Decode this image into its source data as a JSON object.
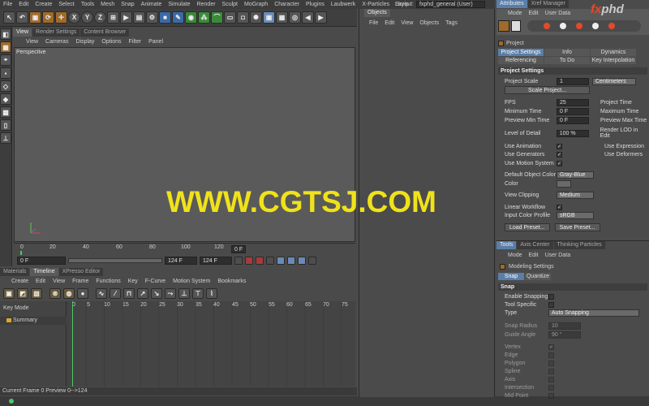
{
  "menubar": {
    "items": [
      "File",
      "Edit",
      "Create",
      "Select",
      "Tools",
      "Mesh",
      "Snap",
      "Animate",
      "Simulate",
      "Render",
      "Sculpt",
      "MoGraph",
      "Character",
      "Plugins",
      "Laubwerk",
      "X-Particles",
      "Scrip"
    ],
    "layout_label": "Layout:",
    "layout_value": "fxphd_general (User)"
  },
  "toolbar": {
    "axis_x": "X",
    "axis_y": "Y",
    "axis_z": "Z"
  },
  "viewport": {
    "tabs": [
      "View",
      "Render Settings",
      "Content Browser"
    ],
    "menu": [
      "View",
      "Cameras",
      "Display",
      "Options",
      "Filter",
      "Panel"
    ],
    "label": "Perspective"
  },
  "timeline_ruler": {
    "ticks": [
      "0",
      "20",
      "40",
      "60",
      "80",
      "100",
      "120"
    ],
    "end_frame": "0 F",
    "start_frame": "0 F",
    "end_value": "124 F",
    "mid_value": "124 F"
  },
  "bottom": {
    "tabs": [
      "Materials",
      "Timeline",
      "XPresso Editor"
    ],
    "menu": [
      "Create",
      "Edit",
      "View",
      "Frame",
      "Functions",
      "Key",
      "F-Curve",
      "Motion System",
      "Bookmarks"
    ],
    "key_mode": "Key Mode",
    "summary": "Summary",
    "ticks": [
      "0",
      "5",
      "10",
      "15",
      "20",
      "25",
      "30",
      "35",
      "40",
      "45",
      "50",
      "55",
      "60",
      "65",
      "70",
      "75"
    ],
    "status": "Current Frame  0  Preview  0-->124"
  },
  "objects": {
    "tab": "Objects",
    "menu": [
      "File",
      "Edit",
      "View",
      "Objects",
      "Tags"
    ]
  },
  "attributes": {
    "tabs": [
      "Attributes",
      "Xref Manager"
    ],
    "menu": [
      "Mode",
      "Edit",
      "User Data"
    ],
    "project_label": "Project",
    "buttons": [
      "Project Settings",
      "Info",
      "Dynamics",
      "Referencing",
      "To Do",
      "Key Interpolation"
    ],
    "section": "Project Settings",
    "project_scale_label": "Project Scale",
    "project_scale_value": "1",
    "project_scale_unit": "Centimeters",
    "scale_project": "Scale Project...",
    "fps_label": "FPS",
    "fps_value": "25",
    "project_time_label": "Project Time",
    "min_time_label": "Minimum Time",
    "min_time_value": "0 F",
    "max_time_label": "Maximum Time",
    "preview_min_label": "Preview Min Time",
    "preview_min_value": "0 F",
    "preview_max_label": "Preview Max Time",
    "lod_label": "Level of Detail",
    "lod_value": "100 %",
    "render_lod_label": "Render LOD in Edit",
    "use_anim": "Use Animation",
    "use_expr": "Use Expression",
    "use_gen": "Use Generators",
    "use_def": "Use Deformers",
    "use_motion": "Use Motion System",
    "default_color_label": "Default Object Color",
    "default_color_value": "Gray-Blue",
    "color_label": "Color",
    "view_clip_label": "View Clipping",
    "view_clip_value": "Medium",
    "linear_wf_label": "Linear Workflow",
    "input_color_label": "Input Color Profile",
    "input_color_value": "sRGB",
    "load_preset": "Load Preset...",
    "save_preset": "Save Preset..."
  },
  "tools": {
    "tabs": [
      "Tools",
      "Axis Center",
      "Thinking Particles"
    ],
    "menu": [
      "Mode",
      "Edit",
      "User Data"
    ],
    "title": "Modeling Settings",
    "subtabs": [
      "Snap",
      "Quantize"
    ],
    "section": "Snap",
    "enable_snapping": "Enable Snapping",
    "tool_specific": "Tool Specific",
    "type_label": "Type",
    "type_value": "Auto Snapping",
    "snap_radius_label": "Snap Radius",
    "snap_radius_value": "10",
    "guide_angle_label": "Guide Angle",
    "guide_angle_value": "90 °",
    "items": [
      "Vertex",
      "Edge",
      "Polygon",
      "Spline",
      "Axis",
      "Intersection",
      "Mid Point"
    ]
  },
  "watermark": "WWW.CGTSJ.COM",
  "logo": {
    "prefix": "fx",
    "suffix": "phd"
  },
  "colors": {
    "accent": "#5a7ea8",
    "watermark": "#f0e21a",
    "playhead": "#4ac86a"
  }
}
